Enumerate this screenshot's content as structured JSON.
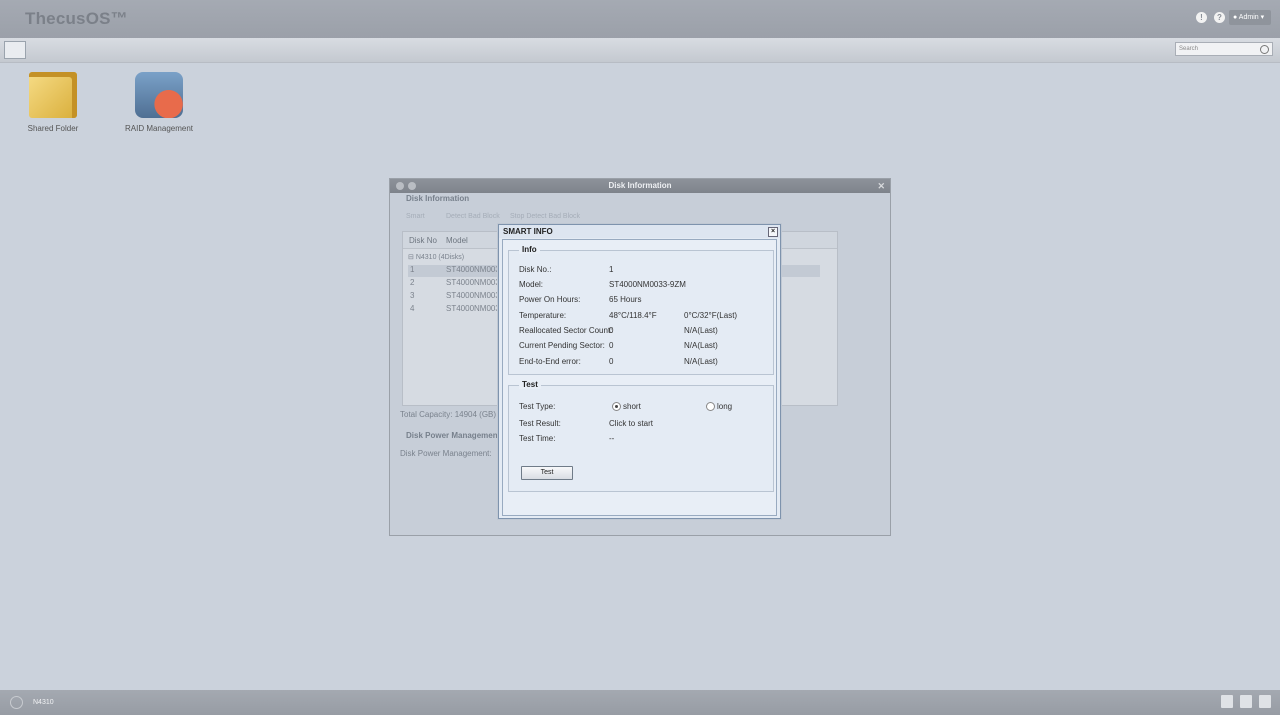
{
  "header": {
    "brand": "ThecusOS™",
    "info_icon": "!",
    "help_icon": "?",
    "user_label": "Admin"
  },
  "toolbar": {
    "search_placeholder": "Search"
  },
  "desktop": {
    "icons": [
      {
        "label": "Shared Folder",
        "icon": "folder-icon"
      },
      {
        "label": "RAID Management",
        "icon": "raid-icon"
      }
    ]
  },
  "disk_window": {
    "title": "Disk Information",
    "section_disk": "Disk Information",
    "toolbar": [
      "Smart",
      "Detect Bad Block",
      "Stop Detect Bad Block"
    ],
    "columns": [
      "Disk No",
      "Model"
    ],
    "group": "N4310 (4Disks)",
    "rows": [
      {
        "no": "1",
        "model": "ST4000NM0033"
      },
      {
        "no": "2",
        "model": "ST4000NM0033"
      },
      {
        "no": "3",
        "model": "ST4000NM0033"
      },
      {
        "no": "4",
        "model": "ST4000NM0033"
      }
    ],
    "total_capacity": "Total Capacity: 14904 (GB)",
    "section_power": "Disk Power Management",
    "power_label": "Disk Power Management:"
  },
  "smart": {
    "title": "SMART INFO",
    "close": "×",
    "info_legend": "Info",
    "info": [
      {
        "label": "Disk No.:",
        "value": "1",
        "last": ""
      },
      {
        "label": "Model:",
        "value": "ST4000NM0033-9ZM",
        "last": ""
      },
      {
        "label": "Power On Hours:",
        "value": "65 Hours",
        "last": ""
      },
      {
        "label": "Temperature:",
        "value": "48°C/118.4°F",
        "last": "0°C/32°F(Last)"
      },
      {
        "label": "Reallocated Sector Count:",
        "value": "0",
        "last": "N/A(Last)"
      },
      {
        "label": "Current Pending Sector:",
        "value": "0",
        "last": "N/A(Last)"
      },
      {
        "label": "End-to-End error:",
        "value": "0",
        "last": "N/A(Last)"
      }
    ],
    "test_legend": "Test",
    "test_type_label": "Test Type:",
    "test_type_short": "short",
    "test_type_long": "long",
    "test_result_label": "Test Result:",
    "test_result_value": "Click to start",
    "test_time_label": "Test Time:",
    "test_time_value": "--",
    "test_button": "Test"
  },
  "footer": {
    "device_name": "N4310"
  }
}
